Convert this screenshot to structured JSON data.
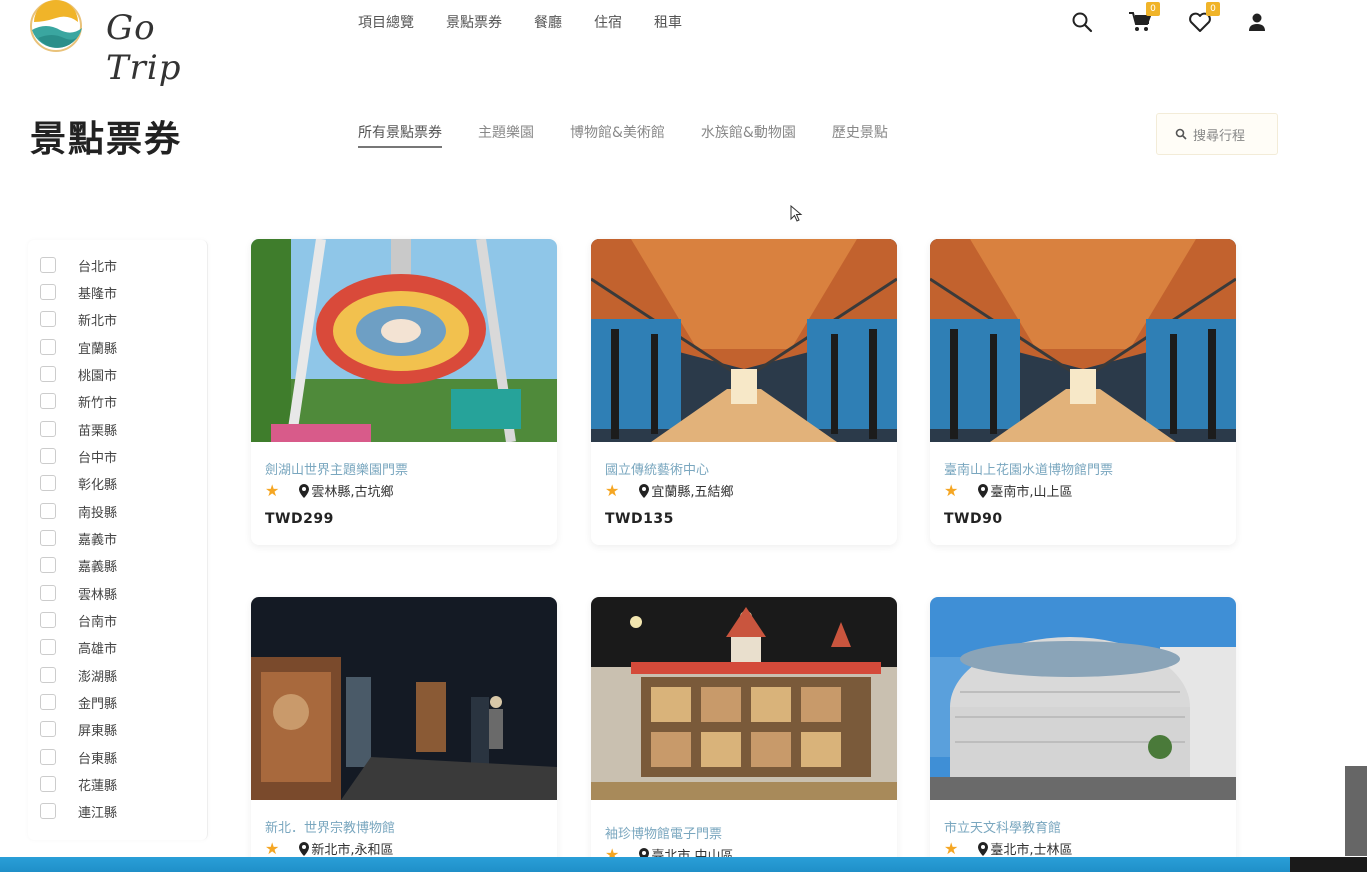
{
  "brand": {
    "name": "Go Trip"
  },
  "nav": [
    "項目總覽",
    "景點票券",
    "餐廳",
    "住宿",
    "租車"
  ],
  "header_icons": {
    "cart_count": "0",
    "wishlist_count": "0"
  },
  "page": {
    "title": "景點票券"
  },
  "tabs": [
    "所有景點票券",
    "主題樂園",
    "博物館&美術館",
    "水族館&動物園",
    "歷史景點"
  ],
  "search": {
    "placeholder": "搜尋行程"
  },
  "regions": [
    "台北市",
    "基隆市",
    "新北市",
    "宜蘭縣",
    "桃園市",
    "新竹市",
    "苗栗縣",
    "台中市",
    "彰化縣",
    "南投縣",
    "嘉義市",
    "嘉義縣",
    "雲林縣",
    "台南市",
    "高雄市",
    "澎湖縣",
    "金門縣",
    "屏東縣",
    "台東縣",
    "花蓮縣",
    "連江縣"
  ],
  "cards": [
    {
      "title": "劍湖山世界主題樂園門票",
      "location": "雲林縣,古坑鄉",
      "price": "TWD299"
    },
    {
      "title": "國立傳統藝術中心",
      "location": "宜蘭縣,五結鄉",
      "price": "TWD135"
    },
    {
      "title": "臺南山上花園水道博物館門票",
      "location": "臺南市,山上區",
      "price": "TWD90"
    },
    {
      "title": "新北．世界宗教博物館",
      "location": "新北市,永和區",
      "price": ""
    },
    {
      "title": "袖珍博物館電子門票",
      "location": "臺北市,中山區",
      "price": ""
    },
    {
      "title": "市立天文科學教育館",
      "location": "臺北市,士林區",
      "price": ""
    }
  ],
  "colors": {
    "accent": "#2a9fd8",
    "badge": "#f0b429",
    "star": "#f5a623",
    "card_title": "#7aa7bf"
  }
}
